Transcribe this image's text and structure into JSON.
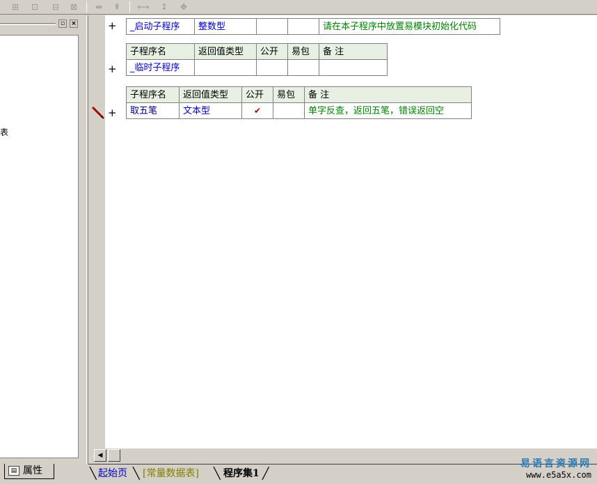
{
  "toolbar": {
    "icons": [
      "insert-row-icon",
      "insert-col-icon",
      "delete-row-icon",
      "delete-col-icon",
      "align-left-icon",
      "align-top-icon",
      "fit-width-icon",
      "fit-height-icon",
      "fit-all-icon"
    ]
  },
  "left_panel": {
    "tree_fragment": "表",
    "bottom_tab": "属性"
  },
  "tables": {
    "startup": {
      "name": "_启动子程序",
      "return_type": "整数型",
      "public": "",
      "easy_pack": "",
      "note": "请在本子程序中放置易模块初始化代码"
    },
    "temp": {
      "headers": [
        "子程序名",
        "返回值类型",
        "公开",
        "易包",
        "备 注"
      ],
      "name": "_临时子程序",
      "return_type": "",
      "public": "",
      "easy_pack": "",
      "note": ""
    },
    "wubi": {
      "headers": [
        "子程序名",
        "返回值类型",
        "公开",
        "易包",
        "备 注"
      ],
      "name": "取五笔",
      "return_type": "文本型",
      "public": "✔",
      "easy_pack": "",
      "note": "单字反查，返回五笔，错误返回空"
    }
  },
  "gutter": {
    "plus": "+"
  },
  "tabs": [
    "起始页",
    "[常量数据表]",
    "程序集1"
  ],
  "colors": {
    "tab_active": "#000000",
    "tab_start": "#0000c0",
    "tab_const": "#808000"
  },
  "watermark": {
    "line1": "易语言资源网",
    "line2": "www.e5a5x.com"
  }
}
